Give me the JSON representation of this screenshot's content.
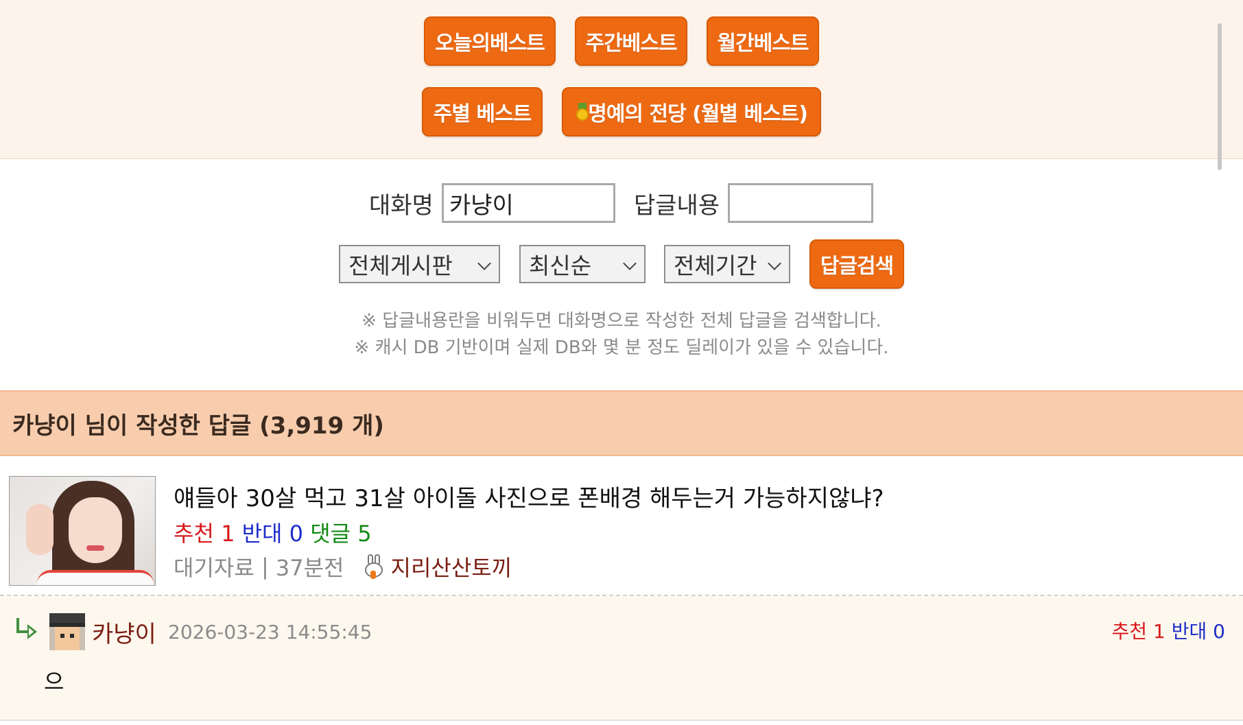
{
  "best_buttons": {
    "today": "오늘의베스트",
    "week": "주간베스트",
    "month": "월간베스트",
    "weekly": "주별 베스트",
    "hall_of_fame": "명예의 전당 (월별 베스트)"
  },
  "search": {
    "nickname_label": "대화명",
    "nickname_value": "카냥이",
    "content_label": "답글내용",
    "content_value": "",
    "board_select": "전체게시판",
    "order_select": "최신순",
    "period_select": "전체기간",
    "submit_label": "답글검색",
    "note1": "※ 답글내용란을 비워두면 대화명으로 작성한 전체 답글을 검색합니다.",
    "note2": "※ 캐시 DB 기반이며 실제 DB와 몇 분 정도 딜레이가 있을 수 있습니다."
  },
  "results": {
    "header": "카냥이 님이 작성한 답글 (3,919 개)"
  },
  "post": {
    "title": "얘들아 30살 먹고 31살 아이돌 사진으로 폰배경 해두는거 가능하지않냐?",
    "recommend_label": "추천",
    "recommend_count": "1",
    "oppose_label": "반대",
    "oppose_count": "0",
    "comment_label": "댓글",
    "comment_count": "5",
    "board": "대기자료",
    "separator": "|",
    "time_ago": "37분전",
    "author": "지리산산토끼"
  },
  "reply": {
    "author": "카냥이",
    "date": "2026-03-23 14:55:45",
    "recommend_label": "추천",
    "recommend_count": "1",
    "oppose_label": "반대",
    "oppose_count": "0",
    "body": "으"
  },
  "colors": {
    "accent_orange": "#ee6a12",
    "header_bg": "#f8cdad",
    "recommend_red": "#d8181c",
    "oppose_blue": "#1d2dc8",
    "comment_green": "#138a13"
  }
}
